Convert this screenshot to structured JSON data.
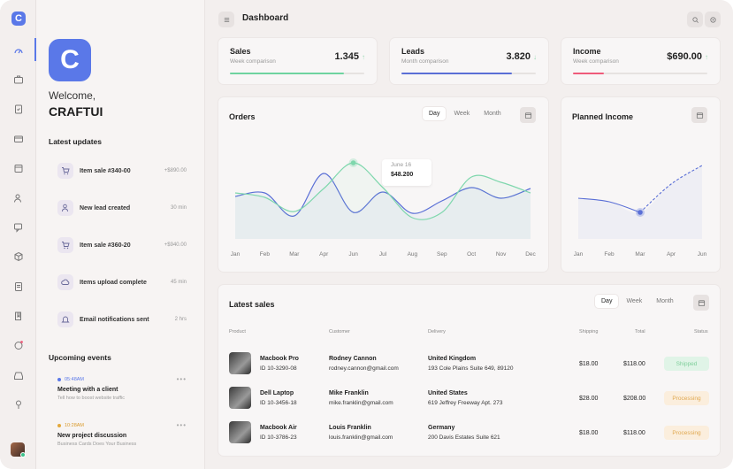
{
  "app": {
    "logo_letter": "C",
    "welcome": "Welcome,",
    "brand": "CRAFTUI"
  },
  "header": {
    "title": "Dashboard"
  },
  "rail": {
    "icons": [
      "dashboard-icon",
      "briefcase-icon",
      "clipboard-icon",
      "card-icon",
      "calendar-icon",
      "users-icon",
      "chat-icon",
      "box-icon",
      "document-icon",
      "book-icon",
      "chart-icon",
      "inbox-icon",
      "pin-icon"
    ]
  },
  "updates": {
    "title": "Latest updates",
    "items": [
      {
        "label": "Item sale #340-00",
        "value": "+$890.00",
        "icon": "cart-icon"
      },
      {
        "label": "New lead created",
        "value": "30 min",
        "icon": "person-icon"
      },
      {
        "label": "Item sale #360-20",
        "value": "+$940.00",
        "icon": "cart-icon"
      },
      {
        "label": "Items upload complete",
        "value": "45 min",
        "icon": "cloud-icon"
      },
      {
        "label": "Email notifications sent",
        "value": "2 hrs",
        "icon": "bell-icon"
      }
    ]
  },
  "events": {
    "title": "Upcoming events",
    "items": [
      {
        "time": "05:48AM",
        "title": "Meeting with a client",
        "sub": "Tell how to boost website traffic"
      },
      {
        "time": "10:28AM",
        "title": "New project discussion",
        "sub": "Business Cards Does Your Business"
      }
    ]
  },
  "stats": [
    {
      "title": "Sales",
      "sub": "Week comparison",
      "value": "1.345",
      "arrow": "↑",
      "progress": 0.85,
      "color": "#6fd3a0"
    },
    {
      "title": "Leads",
      "sub": "Month comparison",
      "value": "3.820",
      "arrow": "↓",
      "progress": 0.82,
      "color": "#5a6fd6"
    },
    {
      "title": "Income",
      "sub": "Week comparison",
      "value": "$690.00",
      "arrow": "↑",
      "progress": 0.23,
      "color": "#ef5b7a"
    }
  ],
  "orders": {
    "title": "Orders",
    "tabs": [
      "Day",
      "Week",
      "Month"
    ],
    "tooltip": {
      "date": "June 16",
      "value": "$48.200"
    }
  },
  "income": {
    "title": "Planned Income"
  },
  "chart_data": [
    {
      "type": "line",
      "categories": [
        "Jan",
        "Feb",
        "Mar",
        "Apr",
        "Jun",
        "Jul",
        "Aug",
        "Sep",
        "Oct",
        "Nov",
        "Dec"
      ],
      "series": [
        {
          "color": "#5a6fd6",
          "values": [
            48,
            52,
            26,
            74,
            30,
            53,
            29,
            43,
            58,
            46,
            57
          ]
        },
        {
          "color": "#7fd7ad",
          "values": [
            52,
            47,
            31,
            57,
            86,
            58,
            24,
            30,
            70,
            64,
            52
          ]
        }
      ],
      "highlight": {
        "category": "Jun",
        "series": 1
      }
    },
    {
      "type": "line",
      "categories": [
        "Jan",
        "Feb",
        "Mar",
        "Apr",
        "Jun"
      ],
      "series": [
        {
          "color": "#5a6fd6",
          "values": [
            46,
            42,
            30,
            62,
            83
          ]
        }
      ],
      "highlight": {
        "category": "Mar",
        "series": 0
      }
    }
  ],
  "sales": {
    "title": "Latest sales",
    "tabs": [
      "Day",
      "Week",
      "Month"
    ],
    "headers": {
      "product": "Product",
      "customer": "Customer",
      "delivery": "Delivery",
      "shipping": "Shipping",
      "total": "Total",
      "status": "Status"
    },
    "rows": [
      {
        "product": "Macbook Pro",
        "id": "ID 10-3290-08",
        "customer": "Rodney Cannon",
        "email": "rodney.cannon@gmail.com",
        "country": "United Kingdom",
        "address": "193 Cole Plains Suite 649, 89120",
        "shipping": "$18.00",
        "total": "$118.00",
        "status": "Shipped",
        "kind": "ship"
      },
      {
        "product": "Dell Laptop",
        "id": "ID 10-3456-18",
        "customer": "Mike Franklin",
        "email": "mike.franklin@gmail.com",
        "country": "United States",
        "address": "619 Jeffrey Freeway Apt. 273",
        "shipping": "$28.00",
        "total": "$208.00",
        "status": "Processing",
        "kind": "proc"
      },
      {
        "product": "Macbook Air",
        "id": "ID 10-3786-23",
        "customer": "Louis Franklin",
        "email": "louis.franklin@gmail.com",
        "country": "Germany",
        "address": "200 Davis Estates Suite 621",
        "shipping": "$18.00",
        "total": "$118.00",
        "status": "Processing",
        "kind": "proc"
      }
    ]
  }
}
